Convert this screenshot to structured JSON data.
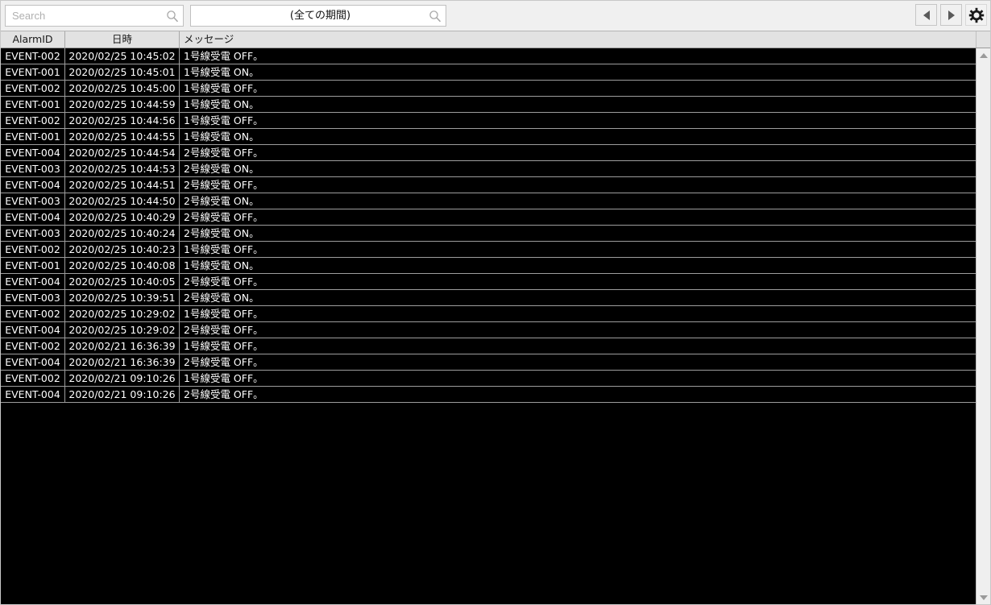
{
  "toolbar": {
    "search": {
      "placeholder": "Search",
      "value": "",
      "icon": "search-icon"
    },
    "period": {
      "value": "(全ての期間)",
      "icon": "search-icon"
    },
    "buttons": [
      {
        "name": "prev-page-button",
        "icon": "triangle-left-icon",
        "label": ""
      },
      {
        "name": "next-page-button",
        "icon": "triangle-right-icon",
        "label": ""
      },
      {
        "name": "settings-button",
        "icon": "gear-icon",
        "label": ""
      }
    ]
  },
  "table": {
    "columns": [
      {
        "key": "alarm_id",
        "label": "AlarmID"
      },
      {
        "key": "datetime",
        "label": "日時"
      },
      {
        "key": "message",
        "label": "メッセージ"
      }
    ],
    "rows": [
      {
        "alarm_id": "EVENT-002",
        "datetime": "2020/02/25 10:45:02",
        "message": "1号線受電 OFF。"
      },
      {
        "alarm_id": "EVENT-001",
        "datetime": "2020/02/25 10:45:01",
        "message": "1号線受電 ON。"
      },
      {
        "alarm_id": "EVENT-002",
        "datetime": "2020/02/25 10:45:00",
        "message": "1号線受電 OFF。"
      },
      {
        "alarm_id": "EVENT-001",
        "datetime": "2020/02/25 10:44:59",
        "message": "1号線受電 ON。"
      },
      {
        "alarm_id": "EVENT-002",
        "datetime": "2020/02/25 10:44:56",
        "message": "1号線受電 OFF。"
      },
      {
        "alarm_id": "EVENT-001",
        "datetime": "2020/02/25 10:44:55",
        "message": "1号線受電 ON。"
      },
      {
        "alarm_id": "EVENT-004",
        "datetime": "2020/02/25 10:44:54",
        "message": "2号線受電 OFF。"
      },
      {
        "alarm_id": "EVENT-003",
        "datetime": "2020/02/25 10:44:53",
        "message": "2号線受電 ON。"
      },
      {
        "alarm_id": "EVENT-004",
        "datetime": "2020/02/25 10:44:51",
        "message": "2号線受電 OFF。"
      },
      {
        "alarm_id": "EVENT-003",
        "datetime": "2020/02/25 10:44:50",
        "message": "2号線受電 ON。"
      },
      {
        "alarm_id": "EVENT-004",
        "datetime": "2020/02/25 10:40:29",
        "message": "2号線受電 OFF。"
      },
      {
        "alarm_id": "EVENT-003",
        "datetime": "2020/02/25 10:40:24",
        "message": "2号線受電 ON。"
      },
      {
        "alarm_id": "EVENT-002",
        "datetime": "2020/02/25 10:40:23",
        "message": "1号線受電 OFF。"
      },
      {
        "alarm_id": "EVENT-001",
        "datetime": "2020/02/25 10:40:08",
        "message": "1号線受電 ON。"
      },
      {
        "alarm_id": "EVENT-004",
        "datetime": "2020/02/25 10:40:05",
        "message": "2号線受電 OFF。"
      },
      {
        "alarm_id": "EVENT-003",
        "datetime": "2020/02/25 10:39:51",
        "message": "2号線受電 ON。"
      },
      {
        "alarm_id": "EVENT-002",
        "datetime": "2020/02/25 10:29:02",
        "message": "1号線受電 OFF。"
      },
      {
        "alarm_id": "EVENT-004",
        "datetime": "2020/02/25 10:29:02",
        "message": "2号線受電 OFF。"
      },
      {
        "alarm_id": "EVENT-002",
        "datetime": "2020/02/21 16:36:39",
        "message": "1号線受電 OFF。"
      },
      {
        "alarm_id": "EVENT-004",
        "datetime": "2020/02/21 16:36:39",
        "message": "2号線受電 OFF。"
      },
      {
        "alarm_id": "EVENT-002",
        "datetime": "2020/02/21 09:10:26",
        "message": "1号線受電 OFF。"
      },
      {
        "alarm_id": "EVENT-004",
        "datetime": "2020/02/21 09:10:26",
        "message": "2号線受電 OFF。"
      }
    ]
  },
  "scrollbar": {
    "up_icon": "triangle-up-icon",
    "down_icon": "triangle-down-icon"
  },
  "colors": {
    "toolbar_bg": "#f0f0f0",
    "header_bg": "#e2e2e2",
    "grid_bg": "#000000",
    "grid_text": "#ffffff",
    "grid_line": "#9d9d9d"
  }
}
